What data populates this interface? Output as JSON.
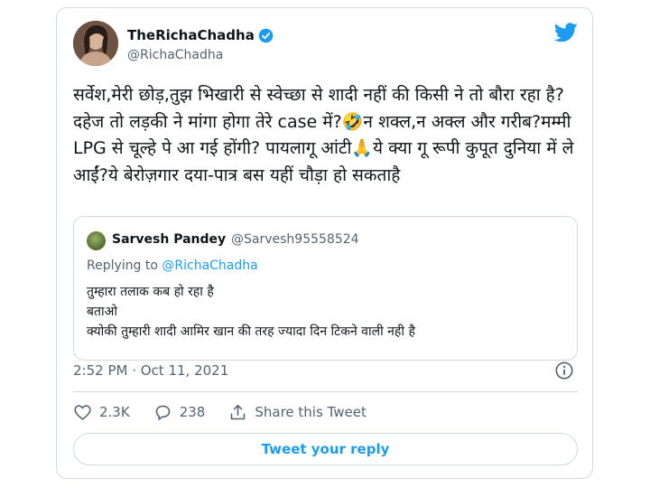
{
  "author": {
    "display_name": "TheRichaChadha",
    "handle": "@RichaChadha",
    "verified": true
  },
  "tweet": {
    "text": "सर्वेश,मेरी छोड़,तुझ भिखारी से स्वेच्छा से शादी नहीं की किसी ने तो बौरा रहा है?दहेज तो लड़की ने मांगा होगा तेरे case में?🤣न शक्ल,न अक्ल और गरीब?मम्मी LPG से चूल्हे पे आ गई होंगी? पायलागू आंटी🙏ये क्या गू रूपी कुपूत दुनिया में ले आईं?ये बेरोज़गार दया-पात्र बस यहीं चौड़ा हो सकताहै",
    "timestamp": "2:52 PM · Oct 11, 2021"
  },
  "quoted": {
    "display_name": "Sarvesh Pandey",
    "handle": "@Sarvesh95558524",
    "replying_prefix": "Replying to ",
    "replying_to": "@RichaChadha",
    "text": "तुम्हारा तलाक कब हो रहा है\nबताओ\nक्योकी तुम्हारी शादी आमिर खान की तरह ज्यादा दिन टिकने वाली नही है"
  },
  "actions": {
    "likes": "2.3K",
    "replies": "238",
    "share_label": "Share this Tweet",
    "reply_button": "Tweet your reply"
  },
  "colors": {
    "accent": "#1d9bf0",
    "secondary_text": "#536471",
    "border": "#cfd9de"
  },
  "icons": [
    "twitter-bird-icon",
    "verified-badge-icon",
    "info-icon",
    "heart-icon",
    "reply-icon",
    "share-icon"
  ]
}
